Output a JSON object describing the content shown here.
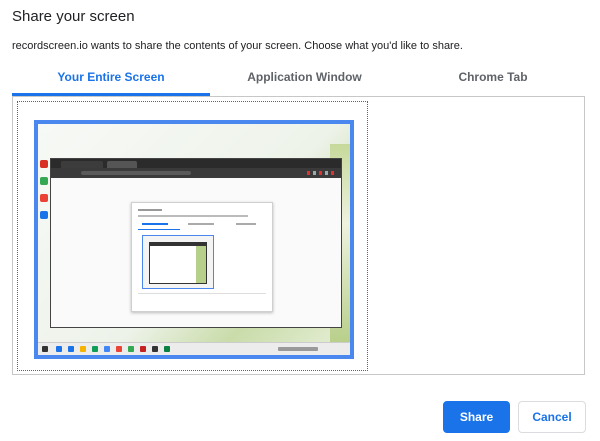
{
  "dialog": {
    "title": "Share your screen",
    "subtitle": "recordscreen.io wants to share the contents of your screen. Choose what you'd like to share."
  },
  "tabs": [
    {
      "label": "Your Entire Screen",
      "active": true
    },
    {
      "label": "Application Window",
      "active": false
    },
    {
      "label": "Chrome Tab",
      "active": false
    }
  ],
  "preview": {
    "selected": true,
    "icon": "screen-thumbnail"
  },
  "buttons": {
    "share_label": "Share",
    "cancel_label": "Cancel"
  },
  "colors": {
    "accent": "#1a73e8",
    "selection_border": "#4a88f0"
  }
}
